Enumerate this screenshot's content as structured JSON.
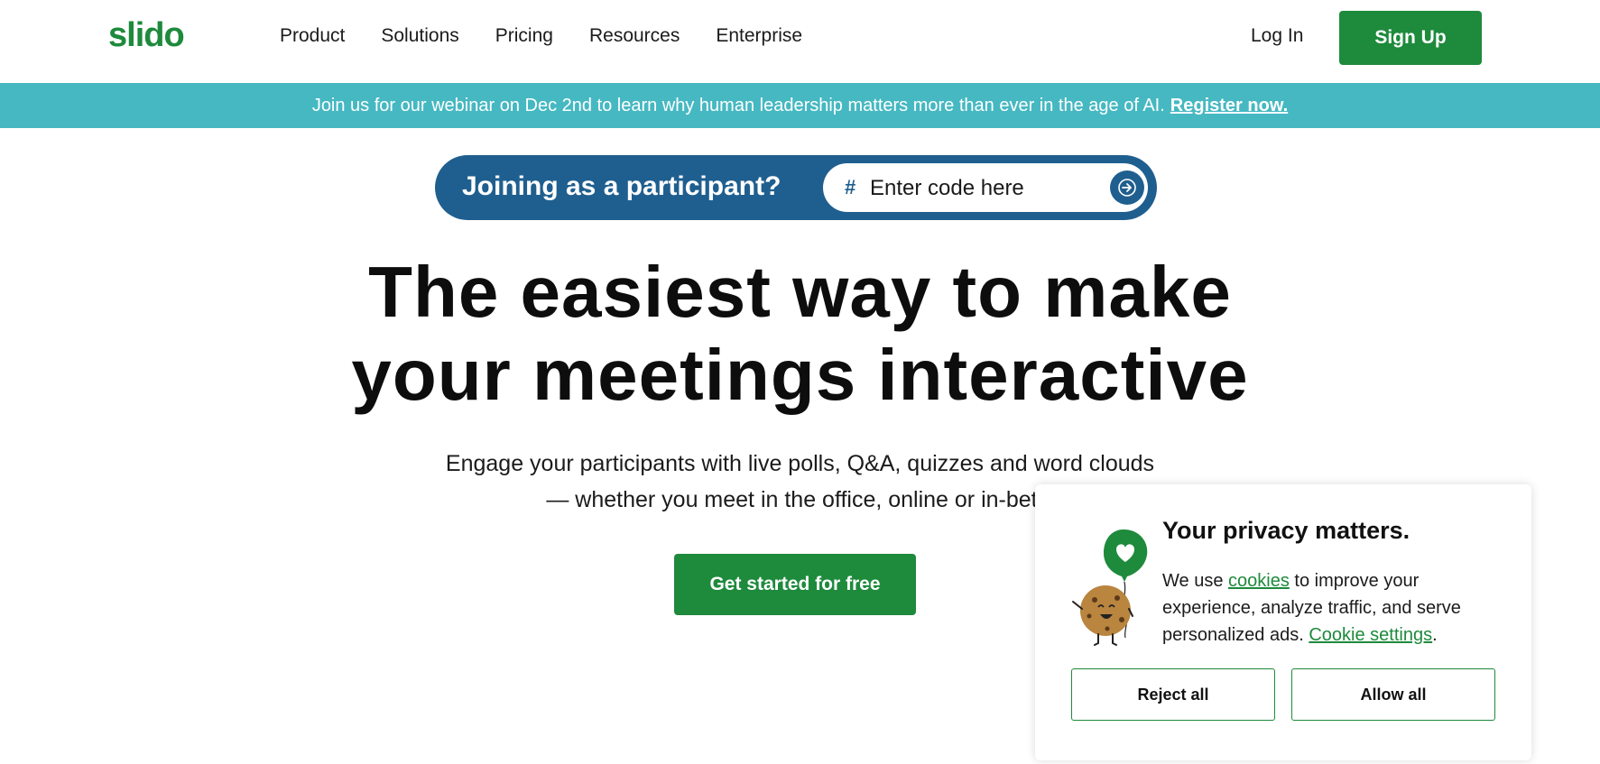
{
  "nav": {
    "logo": "slido",
    "items": [
      "Product",
      "Solutions",
      "Pricing",
      "Resources",
      "Enterprise"
    ],
    "login": "Log In",
    "signup": "Sign Up"
  },
  "banner": {
    "text": "Join us for our webinar on Dec 2nd to learn why human leadership matters more than ever in the age of AI.",
    "link": "Register now."
  },
  "join": {
    "label": "Joining as a participant?",
    "hash": "#",
    "placeholder": "Enter code here"
  },
  "hero": {
    "line1": "The easiest way to make",
    "line2": "your meetings interactive",
    "sub1": "Engage your participants with live polls, Q&A, quizzes and word clouds",
    "sub2": "— whether you meet in the office, online or in-betw",
    "cta": "Get started for free"
  },
  "cookie": {
    "title": "Your privacy matters.",
    "text1": "We use",
    "link1": "cookies",
    "text2": "to improve your experience, analyze traffic, and serve personalized ads.",
    "link2": "Cookie settings",
    "text3": ".",
    "reject": "Reject all",
    "allow": "Allow all"
  },
  "colors": {
    "brand_green": "#1e8a3c",
    "banner_teal": "#46b8c2",
    "join_blue": "#1f5f8f"
  }
}
